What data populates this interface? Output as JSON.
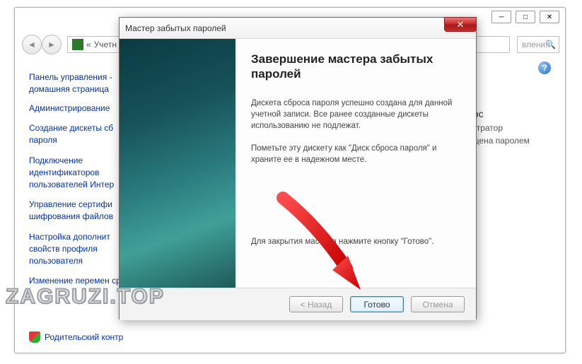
{
  "window": {
    "minimize": "─",
    "maximize": "□",
    "close": "✕"
  },
  "nav": {
    "back_glyph": "◄",
    "fwd_glyph": "►",
    "breadcrumb_prefix": "«",
    "breadcrumb": "Учетн",
    "search_placeholder": "вления",
    "search_btn": "🔍"
  },
  "help_glyph": "?",
  "sidebar": {
    "header": "Панель управления - домашняя страница",
    "links": [
      "Администрирование",
      "Создание дискеты сб пароля",
      "Подключение идентификаторов пользователей Интер",
      "Управление сертифи шифрования файлов",
      "Настройка дополнит свойств профиля пользователя",
      "Изменение перемен среды"
    ]
  },
  "main": {
    "line1": "ерс",
    "line2": "истратор",
    "line3": "ищена паролем"
  },
  "footer": {
    "label": "Родительский контр"
  },
  "wizard": {
    "title": "Мастер забытых паролей",
    "close_glyph": "✕",
    "heading": "Завершение мастера забытых паролей",
    "p1": "Дискета сброса пароля успешно создана для данной учетной записи. Все ранее созданные дискеты использованию не подлежат.",
    "p2": "Пометьте эту дискету как \"Диск сброса пароля\" и храните ее в надежном месте.",
    "instruction": "Для закрытия мастера нажмите кнопку \"Готово\".",
    "buttons": {
      "back": "< Назад",
      "finish": "Готово",
      "cancel": "Отмена"
    }
  },
  "watermark": "ZAGRUZI.TOP"
}
